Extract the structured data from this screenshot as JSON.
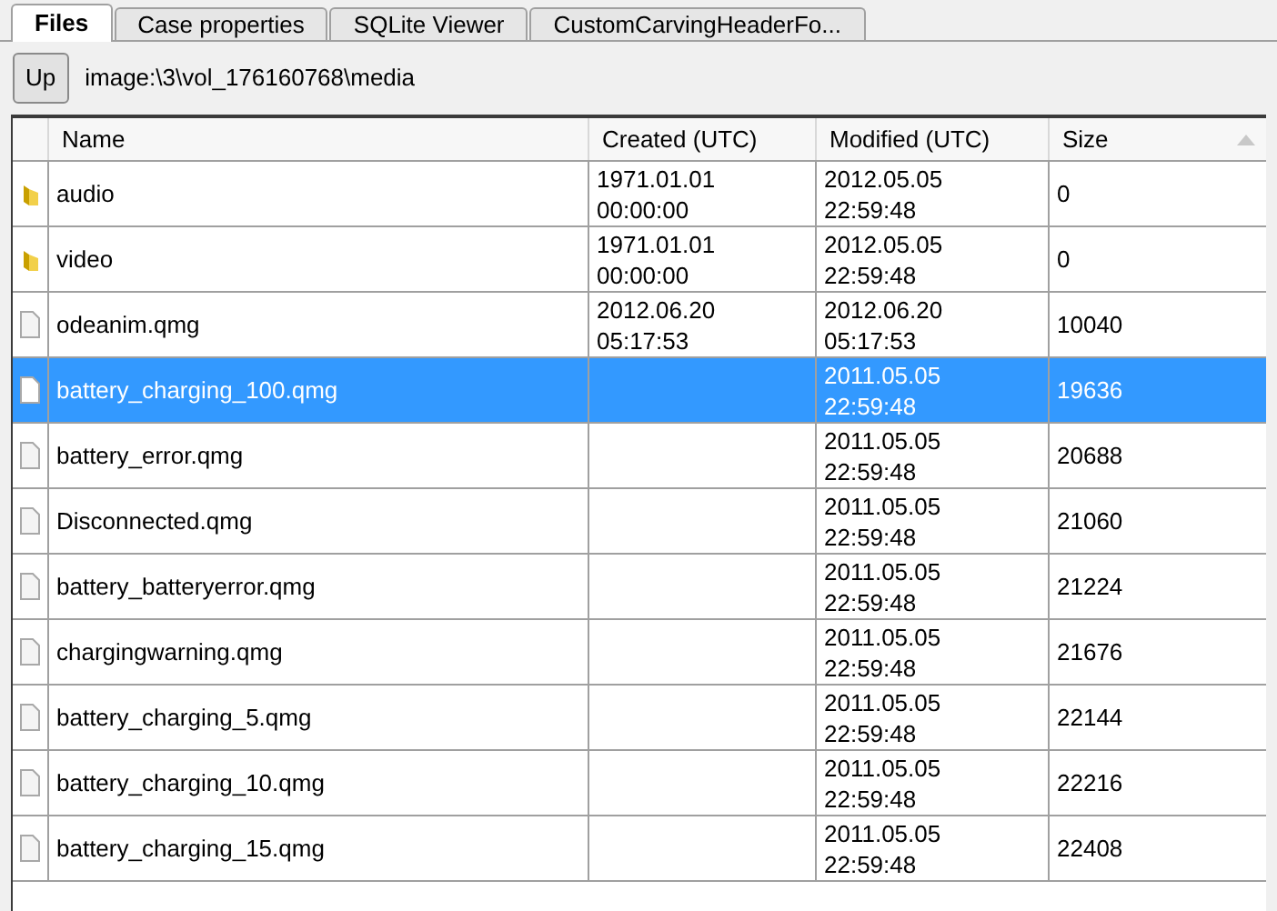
{
  "tabs": [
    {
      "label": "Files",
      "selected": true
    },
    {
      "label": "Case properties",
      "selected": false
    },
    {
      "label": "SQLite Viewer",
      "selected": false
    },
    {
      "label": "CustomCarvingHeaderFo...",
      "selected": false
    }
  ],
  "toolbar": {
    "up_button": "Up",
    "path": "image:\\3\\vol_176160768\\media"
  },
  "table": {
    "columns": [
      "Name",
      "Created (UTC)",
      "Modified (UTC)",
      "Size"
    ],
    "rows": [
      {
        "kind": "folder",
        "name": "audio",
        "created": "1971.01.01\n00:00:00",
        "modified": "2012.05.05\n22:59:48",
        "size": "0",
        "selected": false
      },
      {
        "kind": "folder",
        "name": "video",
        "created": "1971.01.01\n00:00:00",
        "modified": "2012.05.05\n22:59:48",
        "size": "0",
        "selected": false
      },
      {
        "kind": "file",
        "name": "odeanim.qmg",
        "created": "2012.06.20\n05:17:53",
        "modified": "2012.06.20\n05:17:53",
        "size": "10040",
        "selected": false
      },
      {
        "kind": "file",
        "name": "battery_charging_100.qmg",
        "modified": "2011.05.05\n22:59:48",
        "size": "19636",
        "selected": true
      },
      {
        "kind": "file",
        "name": "battery_error.qmg",
        "modified": "2011.05.05\n22:59:48",
        "size": "20688",
        "selected": false
      },
      {
        "kind": "file",
        "name": "Disconnected.qmg",
        "modified": "2011.05.05\n22:59:48",
        "size": "21060",
        "selected": false
      },
      {
        "kind": "file",
        "name": "battery_batteryerror.qmg",
        "modified": "2011.05.05\n22:59:48",
        "size": "21224",
        "selected": false
      },
      {
        "kind": "file",
        "name": "chargingwarning.qmg",
        "modified": "2011.05.05\n22:59:48",
        "size": "21676",
        "selected": false
      },
      {
        "kind": "file",
        "name": "battery_charging_5.qmg",
        "modified": "2011.05.05\n22:59:48",
        "size": "22144",
        "selected": false
      },
      {
        "kind": "file",
        "name": "battery_charging_10.qmg",
        "modified": "2011.05.05\n22:59:48",
        "size": "22216",
        "selected": false
      },
      {
        "kind": "file",
        "name": "battery_charging_15.qmg",
        "modified": "2011.05.05\n22:59:48",
        "size": "22408",
        "selected": false
      }
    ]
  }
}
